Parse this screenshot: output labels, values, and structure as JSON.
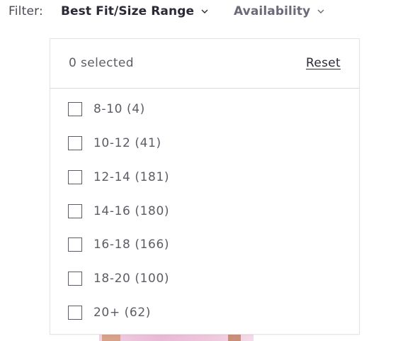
{
  "filter": {
    "label": "Filter:",
    "facets": [
      {
        "label": "Best Fit/Size Range",
        "icon": "chevron-down-icon"
      },
      {
        "label": "Availability",
        "icon": "chevron-down-icon"
      }
    ]
  },
  "dropdown": {
    "selected_text": "0 selected",
    "reset_label": "Reset",
    "options": [
      {
        "label": "8-10 (4)",
        "checked": false
      },
      {
        "label": "10-12 (41)",
        "checked": false
      },
      {
        "label": "12-14 (181)",
        "checked": false
      },
      {
        "label": "14-16 (180)",
        "checked": false
      },
      {
        "label": "16-18 (166)",
        "checked": false
      },
      {
        "label": "18-20 (100)",
        "checked": false
      },
      {
        "label": "20+ (62)",
        "checked": false
      }
    ]
  }
}
